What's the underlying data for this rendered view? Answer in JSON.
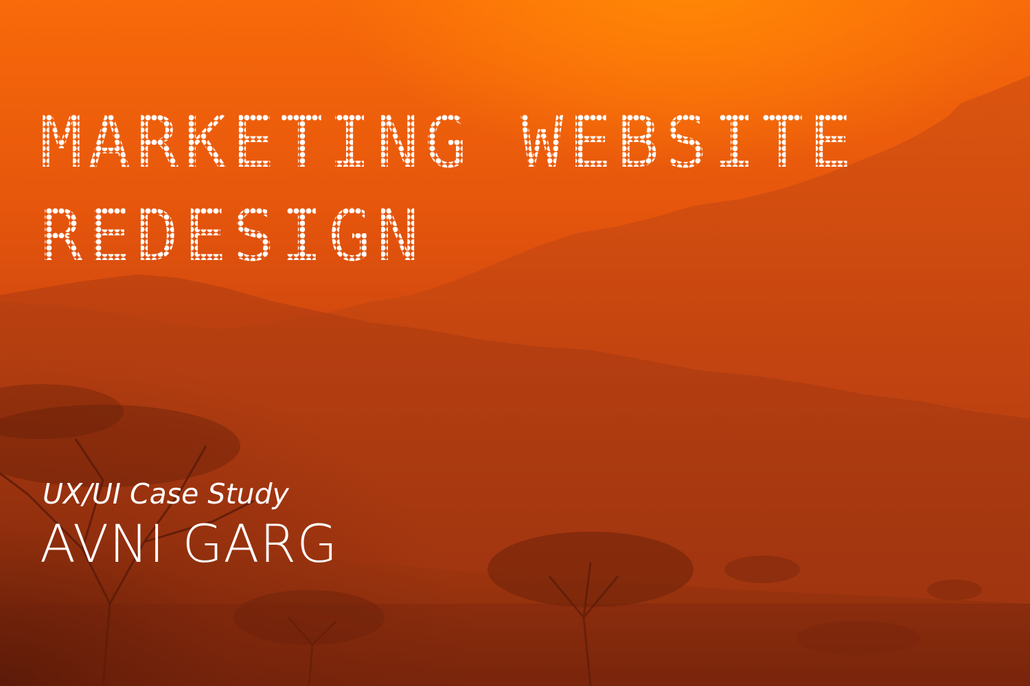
{
  "cover": {
    "title_line_1": "MARKETING WEBSITE",
    "title_line_2": "REDESIGN",
    "subtitle": "UX/UI Case Study",
    "author": "AVNI GARG"
  },
  "colors": {
    "sky_glow": "#ff8a05",
    "sky": "#f86a0a",
    "ground": "#8e2c0e",
    "text": "#ffffff"
  }
}
